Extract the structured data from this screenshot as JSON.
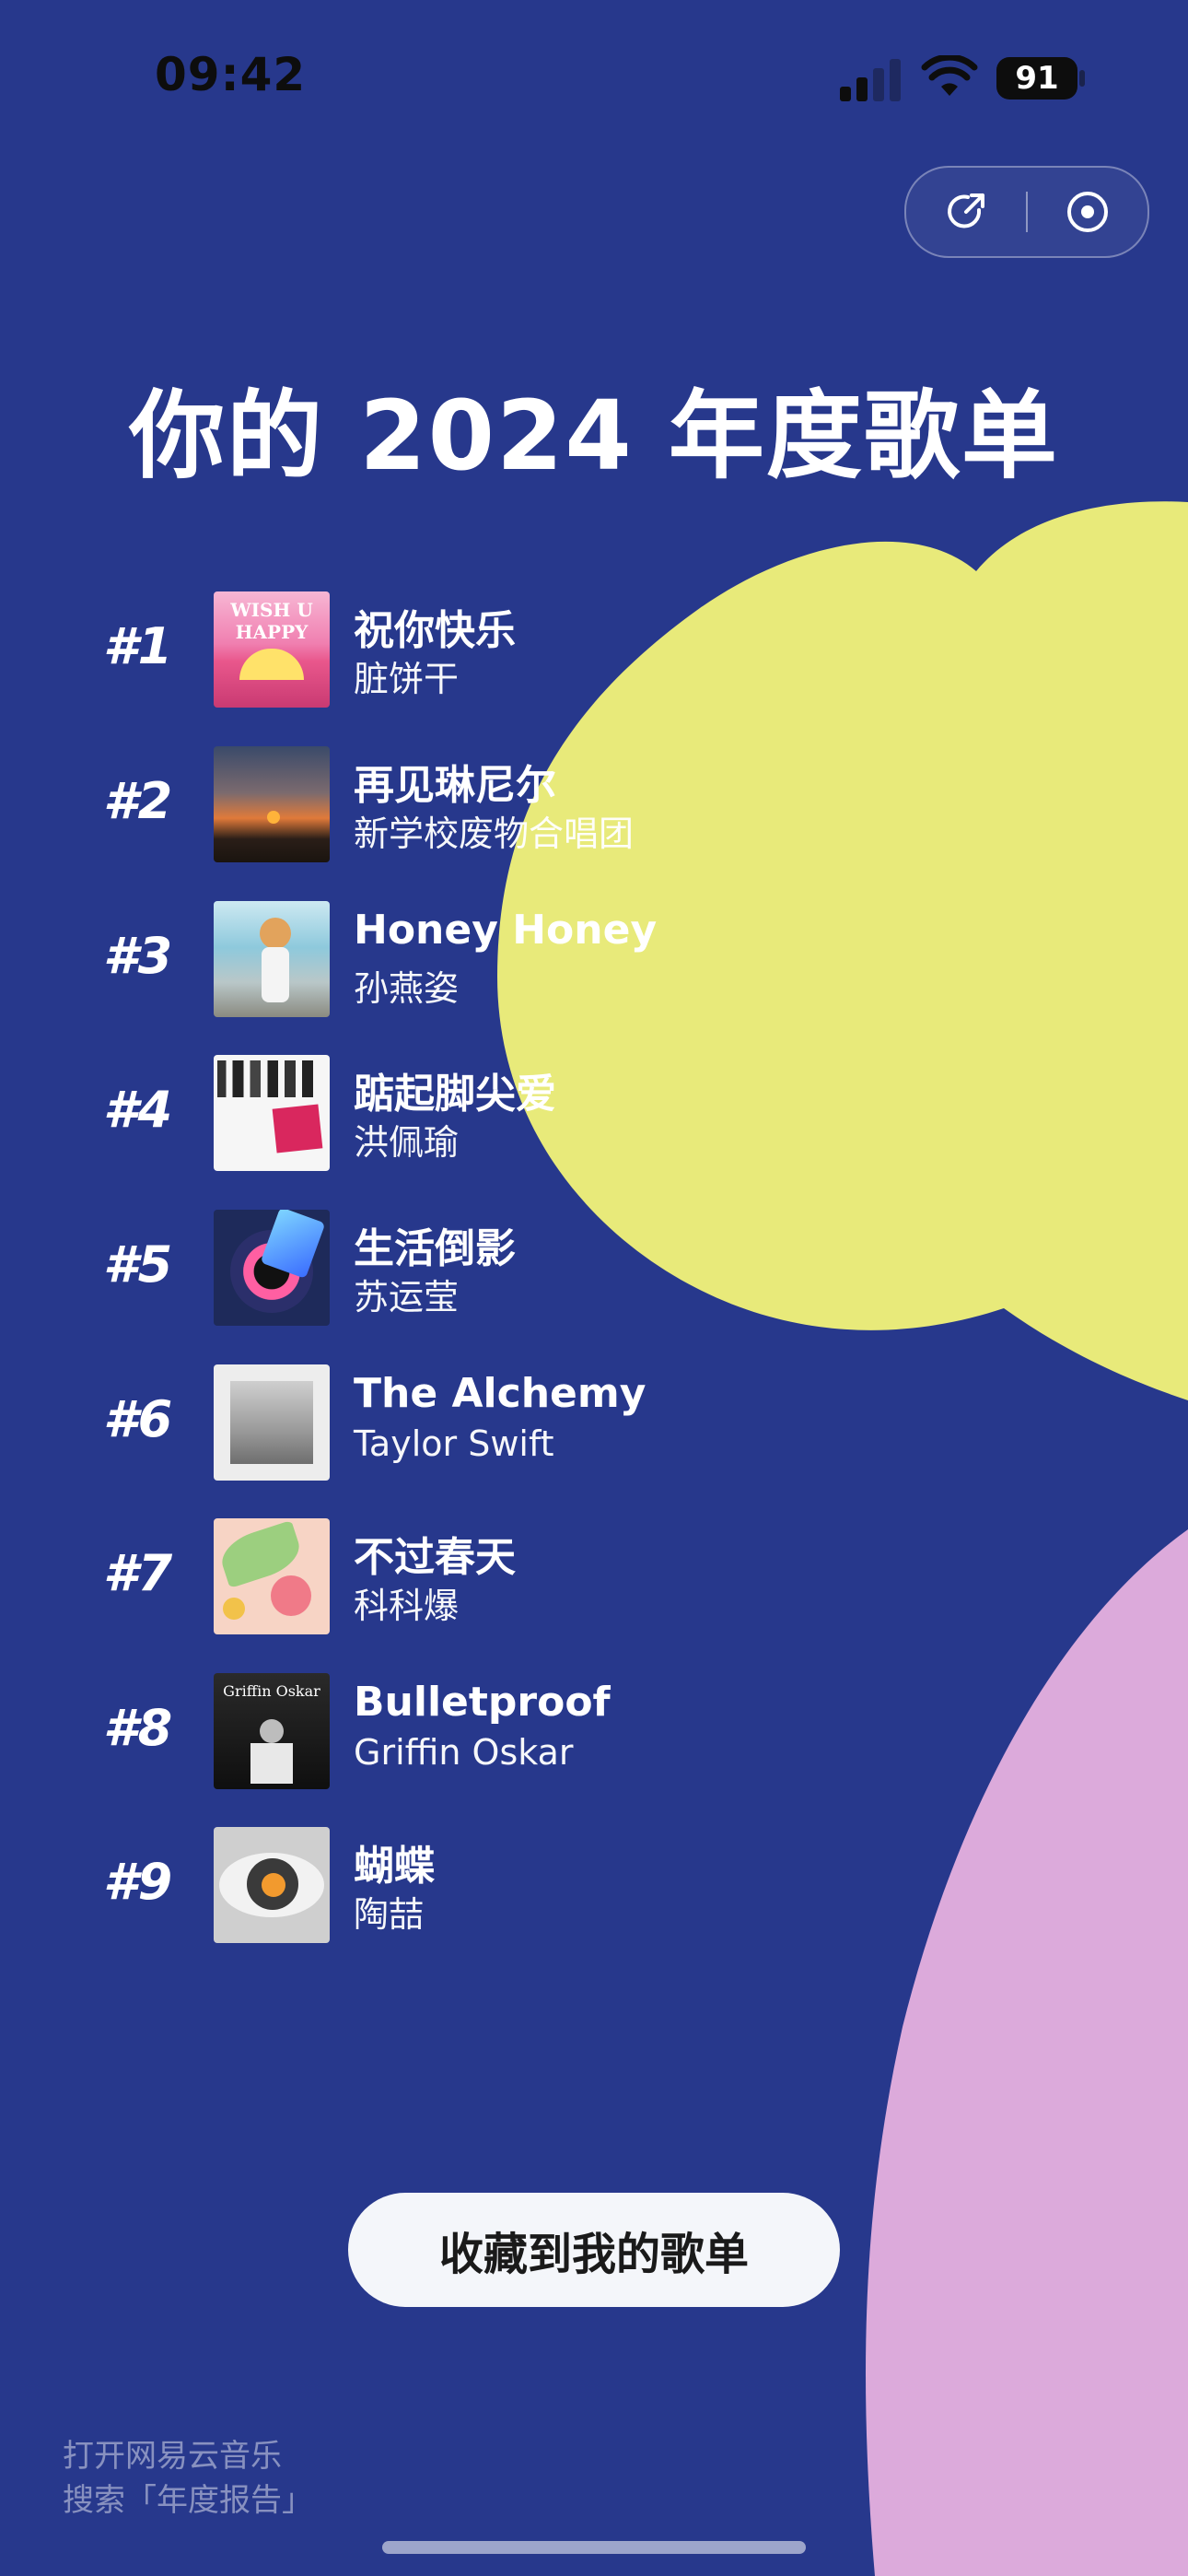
{
  "colors": {
    "background": "#27388c",
    "yellow_blob": "#e8ea7a",
    "pink_blob": "#dcaadb",
    "button_bg": "#f4f6fa"
  },
  "status_bar": {
    "time": "09:42",
    "battery": "91",
    "icons": [
      "signal-icon",
      "wifi-icon",
      "battery-icon"
    ]
  },
  "capsule": {
    "share_icon": "share-arrow-icon",
    "close_icon": "record-circle-icon"
  },
  "title": "你的 2024 年度歌单",
  "songs": [
    {
      "rank": "#1",
      "title": "祝你快乐",
      "artist": "脏饼干",
      "cover_text": "WISH U HAPPY"
    },
    {
      "rank": "#2",
      "title": "再见琳尼尔",
      "artist": "新学校废物合唱团"
    },
    {
      "rank": "#3",
      "title": "Honey Honey",
      "artist": "孙燕姿"
    },
    {
      "rank": "#4",
      "title": "踮起脚尖爱",
      "artist": "洪佩瑜"
    },
    {
      "rank": "#5",
      "title": "生活倒影",
      "artist": "苏运莹"
    },
    {
      "rank": "#6",
      "title": "The Alchemy",
      "artist": "Taylor Swift"
    },
    {
      "rank": "#7",
      "title": "不过春天",
      "artist": "科科爆"
    },
    {
      "rank": "#8",
      "title": "Bulletproof",
      "artist": "Griffin Oskar",
      "cover_text": "Griffin Oskar"
    },
    {
      "rank": "#9",
      "title": "蝴蝶",
      "artist": "陶喆"
    }
  ],
  "save_button": "收藏到我的歌单",
  "footer": {
    "line1": "打开网易云音乐",
    "line2": "搜索「年度报告」"
  }
}
